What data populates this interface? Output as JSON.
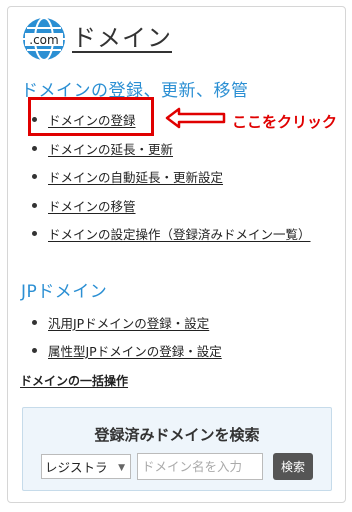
{
  "header": {
    "icon_text": ".com",
    "title": "ドメイン"
  },
  "sections": [
    {
      "title": "ドメインの登録、更新、移管",
      "links": [
        "ドメインの登録",
        "ドメインの延長・更新",
        "ドメインの自動延長・更新設定",
        "ドメインの移管",
        "ドメインの設定操作（登録済みドメイン一覧）"
      ]
    },
    {
      "title": "JPドメイン",
      "links": [
        "汎用JPドメインの登録・設定",
        "属性型JPドメインの登録・設定"
      ]
    }
  ],
  "bulk_link": "ドメインの一括操作",
  "annotation": {
    "text": "ここをクリック",
    "color": "#e00000"
  },
  "search": {
    "title": "登録済みドメインを検索",
    "select_value": "レジストラ",
    "input_placeholder": "ドメイン名を入力",
    "button_label": "検索"
  },
  "colors": {
    "section_title": "#2b8fd3",
    "icon_blue": "#2b8fd3",
    "highlight": "#e00000"
  }
}
